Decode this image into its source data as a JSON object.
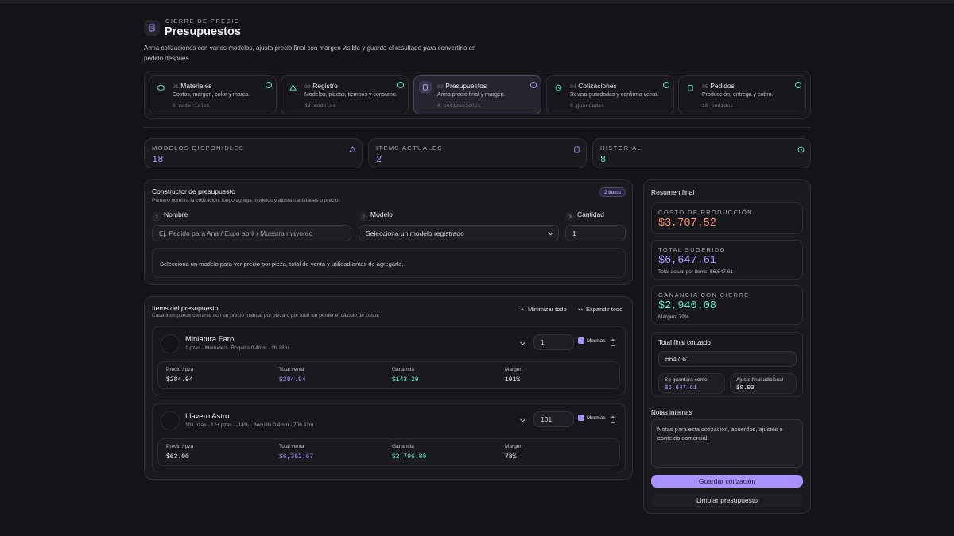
{
  "header": {
    "eyebrow": "CIERRE DE PRECIO",
    "title": "Presupuestos",
    "description_line1": "Arma cotizaciones con varios modelos, ajusta precio final con margen visible y guarda el resultado para convertirlo en",
    "description_line2": "pedido después."
  },
  "steps": [
    {
      "num": "01",
      "title": "Materiales",
      "desc": "Costos, margen, color y marca.",
      "meta": "6 materiales"
    },
    {
      "num": "02",
      "title": "Registro",
      "desc": "Modelos, placas, tiempos y consumo.",
      "meta": "18 modelos"
    },
    {
      "num": "03",
      "title": "Presupuestos",
      "desc": "Arma precio final y margen.",
      "meta": "8 cotizaciones"
    },
    {
      "num": "04",
      "title": "Cotizaciones",
      "desc": "Revisa guardadas y confirma venta.",
      "meta": "8 guardadas"
    },
    {
      "num": "05",
      "title": "Pedidos",
      "desc": "Producción, entrega y cobro.",
      "meta": "18 pedidos"
    }
  ],
  "stats": [
    {
      "label": "MODELOS DISPONIBLES",
      "value": "18",
      "icon": "models-icon"
    },
    {
      "label": "ITEMS ACTUALES",
      "value": "2",
      "icon": "document-icon"
    },
    {
      "label": "HISTORIAL",
      "value": "8",
      "icon": "history-icon"
    }
  ],
  "builder": {
    "title": "Constructor de presupuesto",
    "subtitle": "Primero nombra la cotización, luego agrega modelos y ajusta cantidades o precio.",
    "badge": "2 items",
    "name_step": "1",
    "name_label": "Nombre",
    "name_placeholder": "Ej. Pedido para Ana / Expo abril / Muestra mayoreo",
    "model_step": "2",
    "model_label": "Modelo",
    "model_value": "Selecciona un modelo registrado",
    "qty_step": "3",
    "qty_label": "Cantidad",
    "qty_value": "1",
    "hint": "Selecciona un modelo para ver precio por pieza, total de venta y utilidad antes de agregarlo."
  },
  "items_section": {
    "title": "Items del presupuesto",
    "subtitle": "Cada item puede cerrarse con un precio manual por pieza o por total sin perder el cálculo de costo.",
    "collapse_label": "Minimizar todo",
    "expand_label": "Expandir todo",
    "col_price": "Precio / pza",
    "col_total": "Total venta",
    "col_profit": "Ganancia",
    "col_margin": "Margen",
    "waste_label": "Mermas"
  },
  "items": [
    {
      "name": "Miniatura Faro",
      "meta": "1 pzas · Menudeo · Boquilla 0.4mm · 2h 28m",
      "qty": "1",
      "price": "$284.94",
      "total": "$284.94",
      "profit": "$143.29",
      "margin": "101%"
    },
    {
      "name": "Llavero Astro",
      "meta": "101 pzas · 12+ pzas · -14% · Boquilla 0.4mm · 70h 42m",
      "qty": "101",
      "price": "$63.00",
      "total": "$6,362.67",
      "profit": "$2,796.80",
      "margin": "78%"
    }
  ],
  "summary": {
    "title": "Resumen final",
    "cost_label": "COSTO DE PRODUCCIÓN",
    "cost_value": "$3,707.52",
    "suggested_label": "TOTAL SUGERIDO",
    "suggested_value": "$6,647.61",
    "suggested_sub": "Total actual por items: $6,647.61",
    "profit_label": "GANANCIA CON CIERRE",
    "profit_value": "$2,940.08",
    "profit_sub": "Margen: 79%",
    "final_label": "Total final cotizado",
    "final_value": "6647.61",
    "saved_label": "Se guardará como",
    "saved_value": "$6,647.61",
    "adjust_label": "Ajuste final adicional",
    "adjust_value": "$0.00",
    "notes_label": "Notas internas",
    "notes_placeholder": "Notas para esta cotización, acuerdos, ajustes o contexto comercial.",
    "save_button": "Guardar cotización",
    "clear_button": "Limpiar presupuesto"
  },
  "colors": {
    "accent": "#a994ff",
    "positive": "#5ee6c4",
    "cost": "#ff8c6b",
    "background": "#141416"
  }
}
